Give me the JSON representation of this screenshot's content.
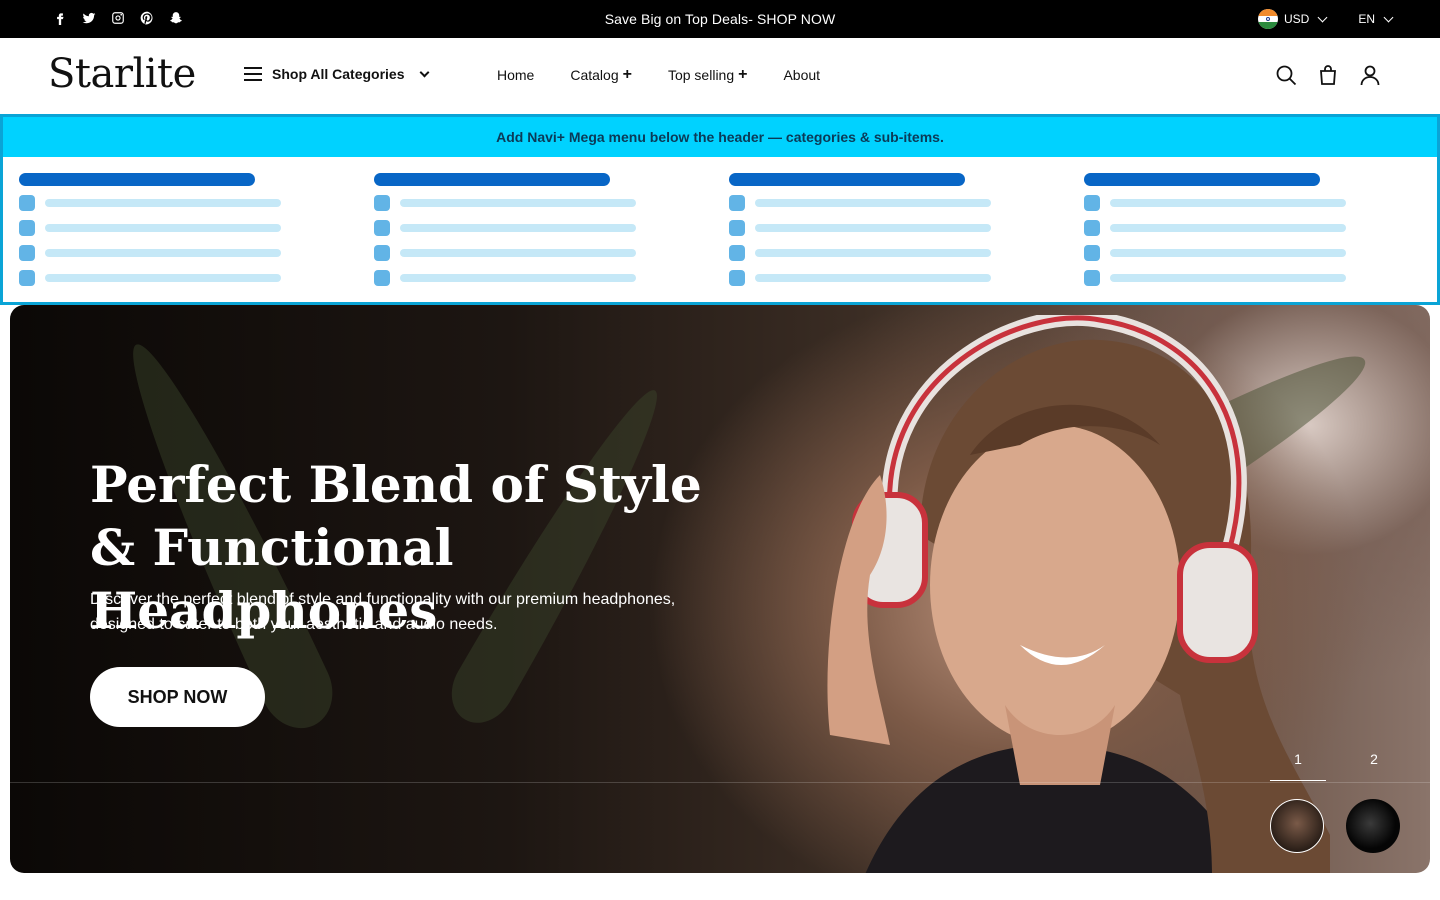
{
  "topbar": {
    "social": [
      "facebook-icon",
      "twitter-icon",
      "instagram-icon",
      "pinterest-icon",
      "snapchat-icon"
    ],
    "announcement": "Save Big on Top Deals- SHOP NOW",
    "currency": "USD",
    "language": "EN"
  },
  "header": {
    "logo": "Starlite",
    "categories_label": "Shop All Categories",
    "nav": [
      {
        "label": "Home"
      },
      {
        "label": "Catalog",
        "plus": "+"
      },
      {
        "label": "Top selling",
        "plus": "+"
      },
      {
        "label": "About"
      }
    ],
    "icons": [
      "search-icon",
      "cart-icon",
      "account-icon"
    ]
  },
  "mega_menu": {
    "banner": "Add Navi+ Mega menu below the header — categories & sub-items."
  },
  "hero": {
    "title": "Perfect Blend of Style & Functional Headphones",
    "description": "Discover the perfect blend of style and functionality with our premium headphones, designed to cater to both your aesthetic and audio needs.",
    "cta": "SHOP NOW",
    "slides": [
      {
        "number": "1"
      },
      {
        "number": "2"
      }
    ],
    "active_slide": "1"
  },
  "colors": {
    "topbar_bg": "#000000",
    "mega_banner": "#00d2ff",
    "mega_border": "#0aa4d6",
    "mega_heading_bar": "#0866c6",
    "mega_item_square": "#62b4e6",
    "mega_item_line": "#c5e8f7"
  }
}
